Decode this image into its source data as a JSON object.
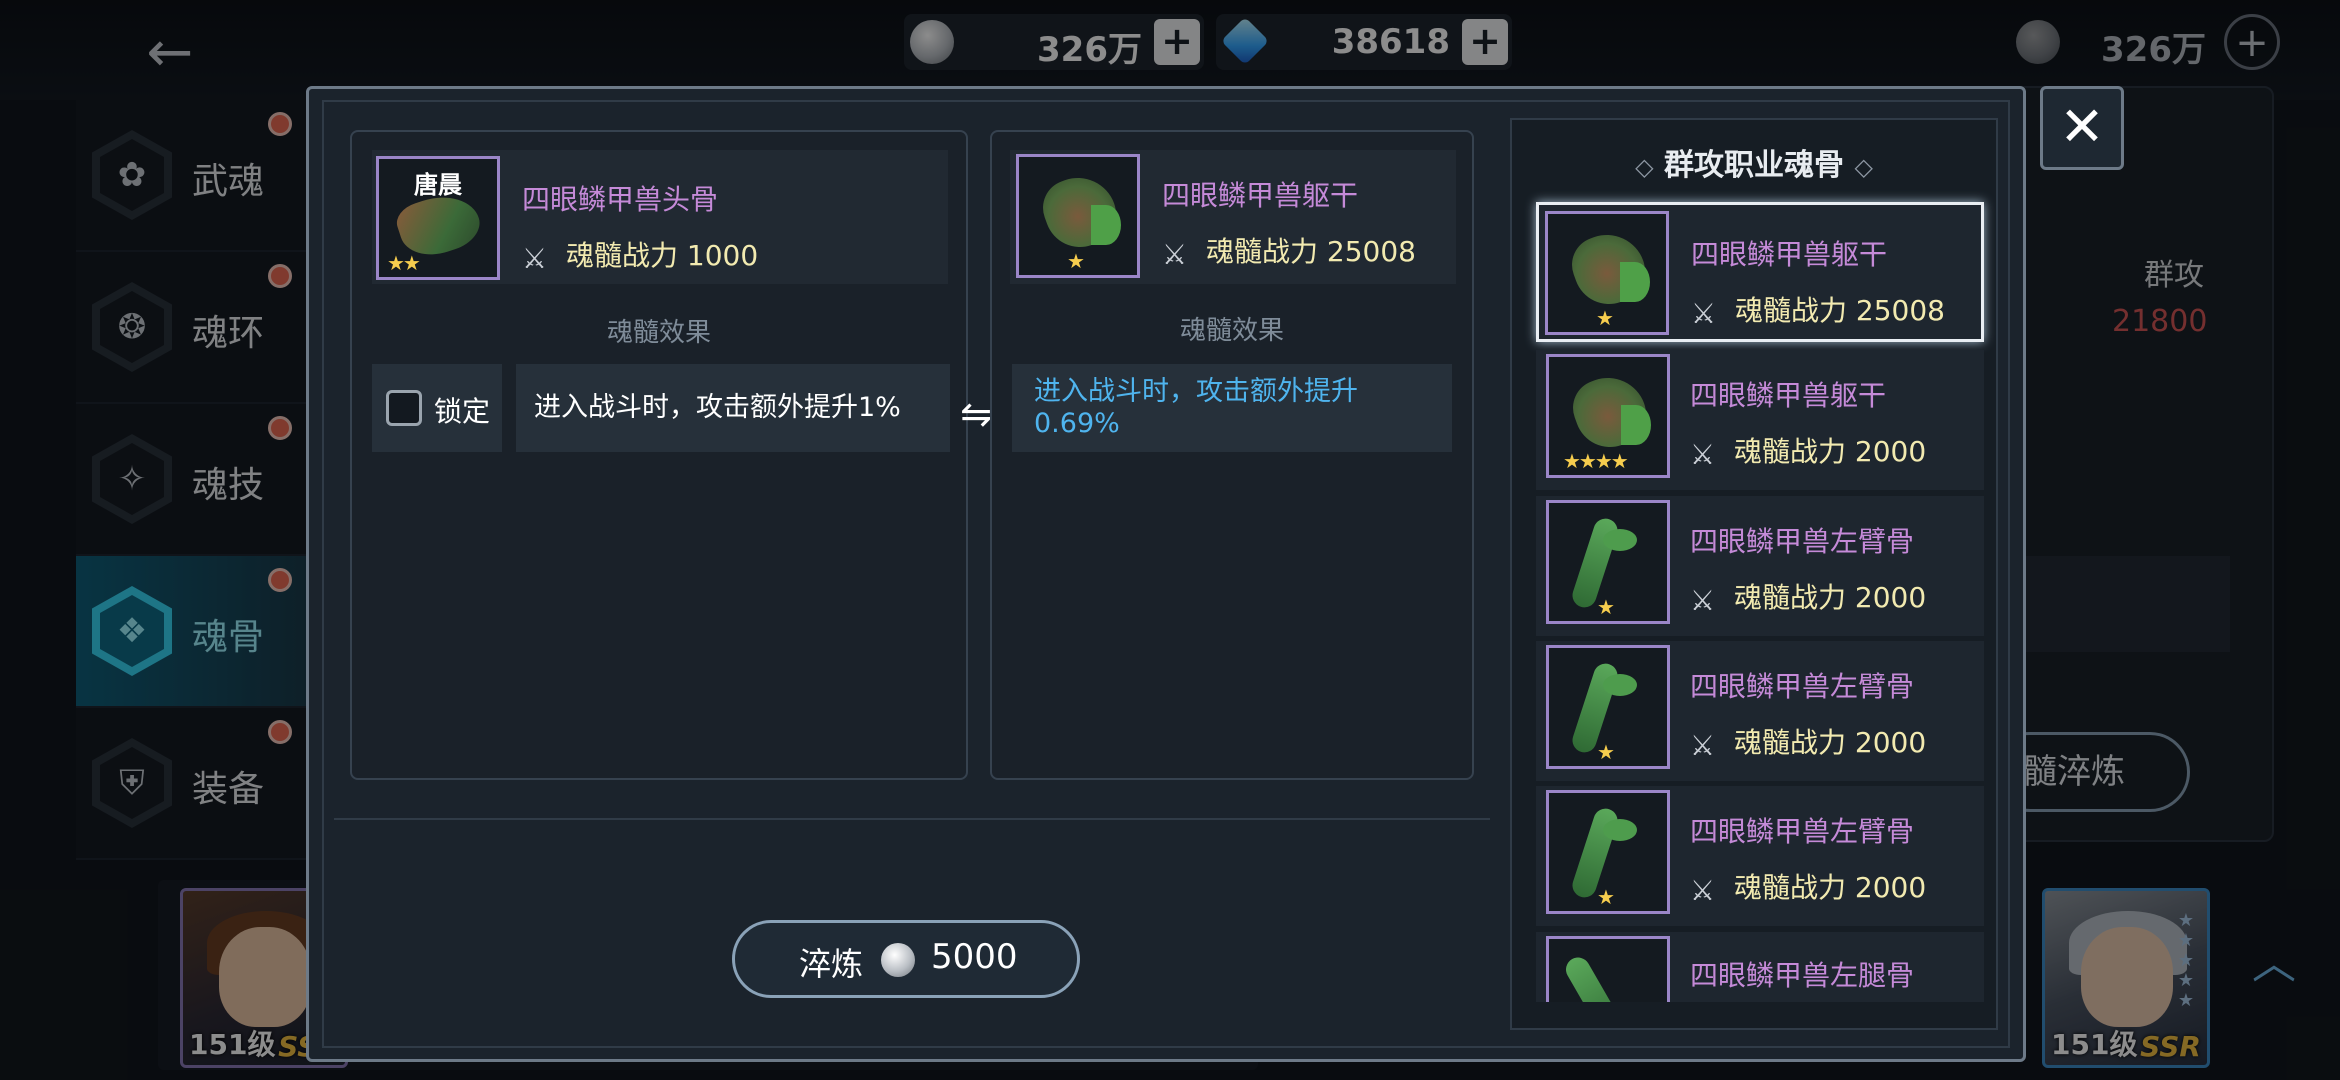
{
  "currency": {
    "coins": "326万",
    "gems": "38618",
    "coins_right": "326万",
    "plus": "+"
  },
  "nav": {
    "back": "←",
    "items": [
      {
        "label": "武魂",
        "icon": "✿"
      },
      {
        "label": "魂环",
        "icon": "❂"
      },
      {
        "label": "魂技",
        "icon": "✧"
      },
      {
        "label": "魂骨",
        "icon": "❖"
      },
      {
        "label": "装备",
        "icon": "⛨"
      }
    ]
  },
  "background_panel": {
    "label": "群攻",
    "value": "21800",
    "button": "髓淬炼"
  },
  "modal": {
    "close": "✕",
    "current": {
      "owner": "唐晨",
      "stars": "★★",
      "name": "四眼鳞甲兽头骨",
      "power_label": "魂髓战力",
      "power": "1000",
      "effect_title": "魂髓效果",
      "lock_label": "锁定",
      "effect": "进入战斗时，攻击额外提升1%"
    },
    "swap_icon": "⇋",
    "target": {
      "stars": "★",
      "name": "四眼鳞甲兽躯干",
      "power_label": "魂髓战力",
      "power": "25008",
      "effect_title": "魂髓效果",
      "effect": "进入战斗时，攻击额外提升0.69%"
    },
    "refine": {
      "label": "淬炼",
      "cost": "5000"
    },
    "list": {
      "title": "群攻职业魂骨",
      "deco_left": "◇",
      "deco_right": "◇",
      "items": [
        {
          "name": "四眼鳞甲兽躯干",
          "power_label": "魂髓战力",
          "power": "25008",
          "stars": "★",
          "kind": "torso"
        },
        {
          "name": "四眼鳞甲兽躯干",
          "power_label": "魂髓战力",
          "power": "2000",
          "stars": "★★★★",
          "kind": "torso"
        },
        {
          "name": "四眼鳞甲兽左臂骨",
          "power_label": "魂髓战力",
          "power": "2000",
          "stars": "★",
          "kind": "arm"
        },
        {
          "name": "四眼鳞甲兽左臂骨",
          "power_label": "魂髓战力",
          "power": "2000",
          "stars": "★",
          "kind": "arm"
        },
        {
          "name": "四眼鳞甲兽左臂骨",
          "power_label": "魂髓战力",
          "power": "2000",
          "stars": "★",
          "kind": "arm"
        },
        {
          "name": "四眼鳞甲兽左腿骨",
          "kind": "leg"
        }
      ]
    }
  },
  "bottom": {
    "left_level": "151级",
    "left_rank": "SSR",
    "right_level": "151级",
    "right_rank": "SSR"
  }
}
